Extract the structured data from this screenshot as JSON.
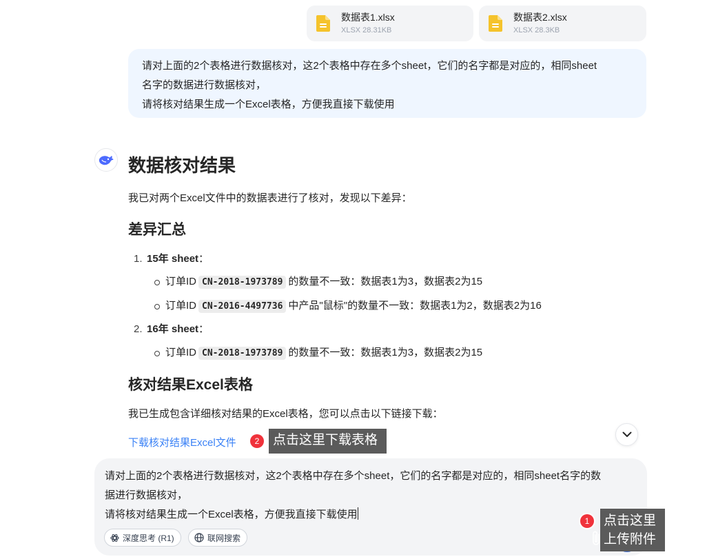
{
  "attachments": [
    {
      "name": "数据表1.xlsx",
      "meta": "XLSX 28.31KB",
      "icon": "excel-file-icon"
    },
    {
      "name": "数据表2.xlsx",
      "meta": "XLSX 28.3KB",
      "icon": "excel-file-icon"
    }
  ],
  "user_message": {
    "line1": "请对上面的2个表格进行数据核对，这2个表格中存在多个sheet，它们的名字都是对应的，相同sheet",
    "line2": "名字的数据进行数据核对，",
    "line3": "请将核对结果生成一个Excel表格，方便我直接下载使用"
  },
  "assistant": {
    "avatar_icon": "whale-logo-icon",
    "title": "数据核对结果",
    "intro": "我已对两个Excel文件中的数据表进行了核对，发现以下差异：",
    "section1_title": "差异汇总",
    "items": [
      {
        "num": "1.",
        "label": "15年 sheet",
        "colon": "：",
        "bullets": [
          {
            "prefix": "订单ID",
            "code": "CN-2018-1973789",
            "suffix": "的数量不一致：数据表1为3，数据表2为15"
          },
          {
            "prefix": "订单ID",
            "code": "CN-2016-4497736",
            "suffix": "中产品\"鼠标\"的数量不一致：数据表1为2，数据表2为16"
          }
        ]
      },
      {
        "num": "2.",
        "label": "16年 sheet",
        "colon": "：",
        "bullets": [
          {
            "prefix": "订单ID",
            "code": "CN-2018-1973789",
            "suffix": "的数量不一致：数据表1为3，数据表2为15"
          }
        ]
      }
    ],
    "section2_title": "核对结果Excel表格",
    "download_intro": "我已生成包含详细核对结果的Excel表格，您可以点击以下链接下载：",
    "download_link": "下载核对结果Excel文件"
  },
  "tooltips": {
    "download": {
      "badge": "2",
      "text": "点击这里下载表格"
    },
    "upload": {
      "badge": "1",
      "line1": "点击这里",
      "line2": "上传附件"
    }
  },
  "composer": {
    "line1": "请对上面的2个表格进行数据核对，这2个表格中存在多个sheet，它们的名字都是对应的，相同sheet名字的数",
    "line2": "据进行数据核对，",
    "line3": "请将核对结果生成一个Excel表格，方便我直接下载使用",
    "deep_think": "深度思考 (R1)",
    "web_search": "联网搜索"
  },
  "colors": {
    "accent": "#3b82f6",
    "user_bubble": "#eff6ff",
    "badge": "#f0323b",
    "file_icon": "#f5c32c"
  }
}
